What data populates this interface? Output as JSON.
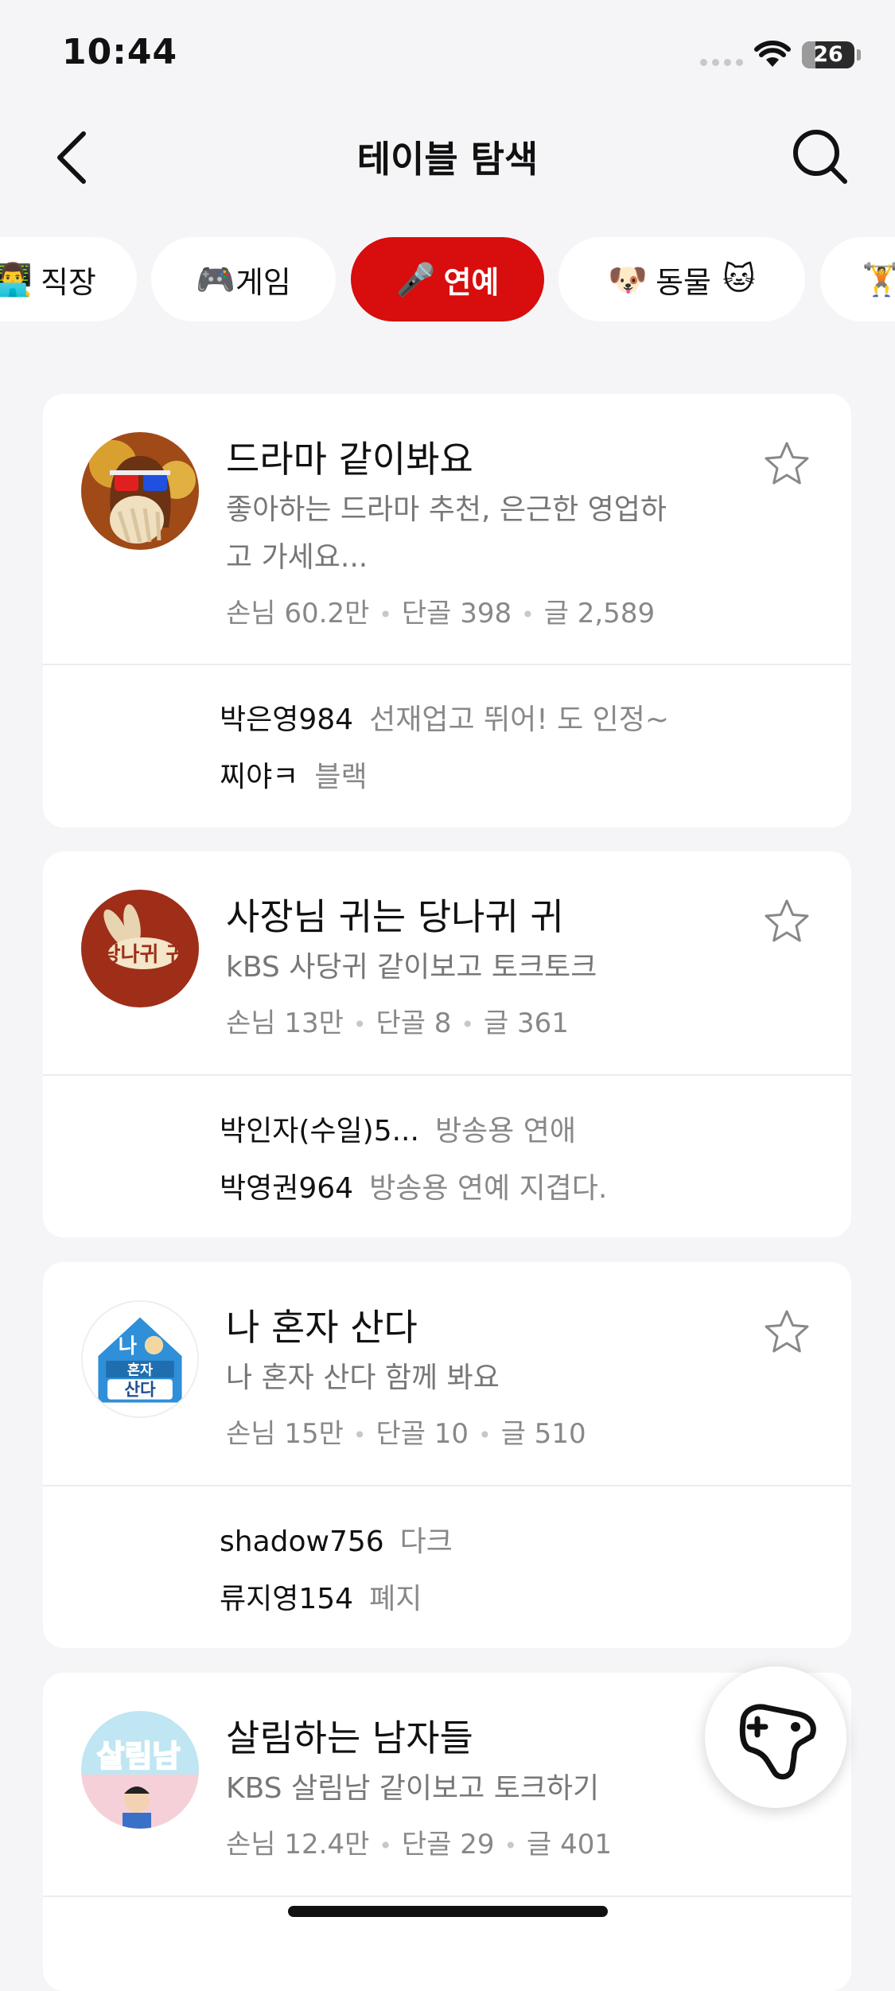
{
  "status_bar": {
    "time": "10:44",
    "battery": "26",
    "battery_level": 0.26
  },
  "header": {
    "title": "테이블 탐색",
    "back_icon": "chevron-left-icon",
    "search_icon": "search-icon"
  },
  "categories": [
    {
      "emoji": "👨‍💻",
      "label": "직장",
      "active": false
    },
    {
      "emoji": "🎮",
      "label": "게임",
      "active": false
    },
    {
      "emoji": "🎤",
      "label": "연예",
      "active": true
    },
    {
      "emoji": "🐶",
      "label": "동물",
      "emoji_after": "🐱",
      "active": false
    },
    {
      "emoji": "🏋️",
      "label": "",
      "active": false
    }
  ],
  "tables": [
    {
      "title": "드라마 같이봐요",
      "description": "좋아하는 드라마 추천, 은근한 영업하고 가세요...",
      "stats": {
        "guests": "손님 60.2만",
        "regulars": "단골 398",
        "posts": "글 2,589"
      },
      "comments": [
        {
          "user": "박은영984",
          "text": "선재업고 뛰어! 도 인정~"
        },
        {
          "user": "찌야ㅋ",
          "text": "블랙"
        }
      ]
    },
    {
      "title": "사장님 귀는 당나귀 귀",
      "description": "kBS 사당귀 같이보고 토크토크",
      "stats": {
        "guests": "손님 13만",
        "regulars": "단골 8",
        "posts": "글 361"
      },
      "comments": [
        {
          "user": "박인자(수일)5...",
          "text": "방송용 연애"
        },
        {
          "user": "박영권964",
          "text": "방송용 연예 지겹다."
        }
      ]
    },
    {
      "title": "나 혼자 산다",
      "description": "나 혼자 산다 함께 봐요",
      "stats": {
        "guests": "손님 15만",
        "regulars": "단골 10",
        "posts": "글 510"
      },
      "comments": [
        {
          "user": "shadow756",
          "text": "다크"
        },
        {
          "user": "류지영154",
          "text": "폐지"
        }
      ]
    },
    {
      "title": "살림하는 남자들",
      "description": "KBS 살림남 같이보고 토크하기",
      "stats": {
        "guests": "손님 12.4만",
        "regulars": "단골 29",
        "posts": "글 401"
      },
      "comments": []
    }
  ],
  "logo_text": {
    "donkey": "당나귀 귀",
    "alone_1": "나",
    "alone_2": "혼자",
    "alone_3": "산다",
    "salim": "살림남"
  },
  "colors": {
    "accent": "#d80d0d",
    "background": "#f5f5f7",
    "card": "#ffffff"
  },
  "fab_icon": "game-controller-add-icon"
}
